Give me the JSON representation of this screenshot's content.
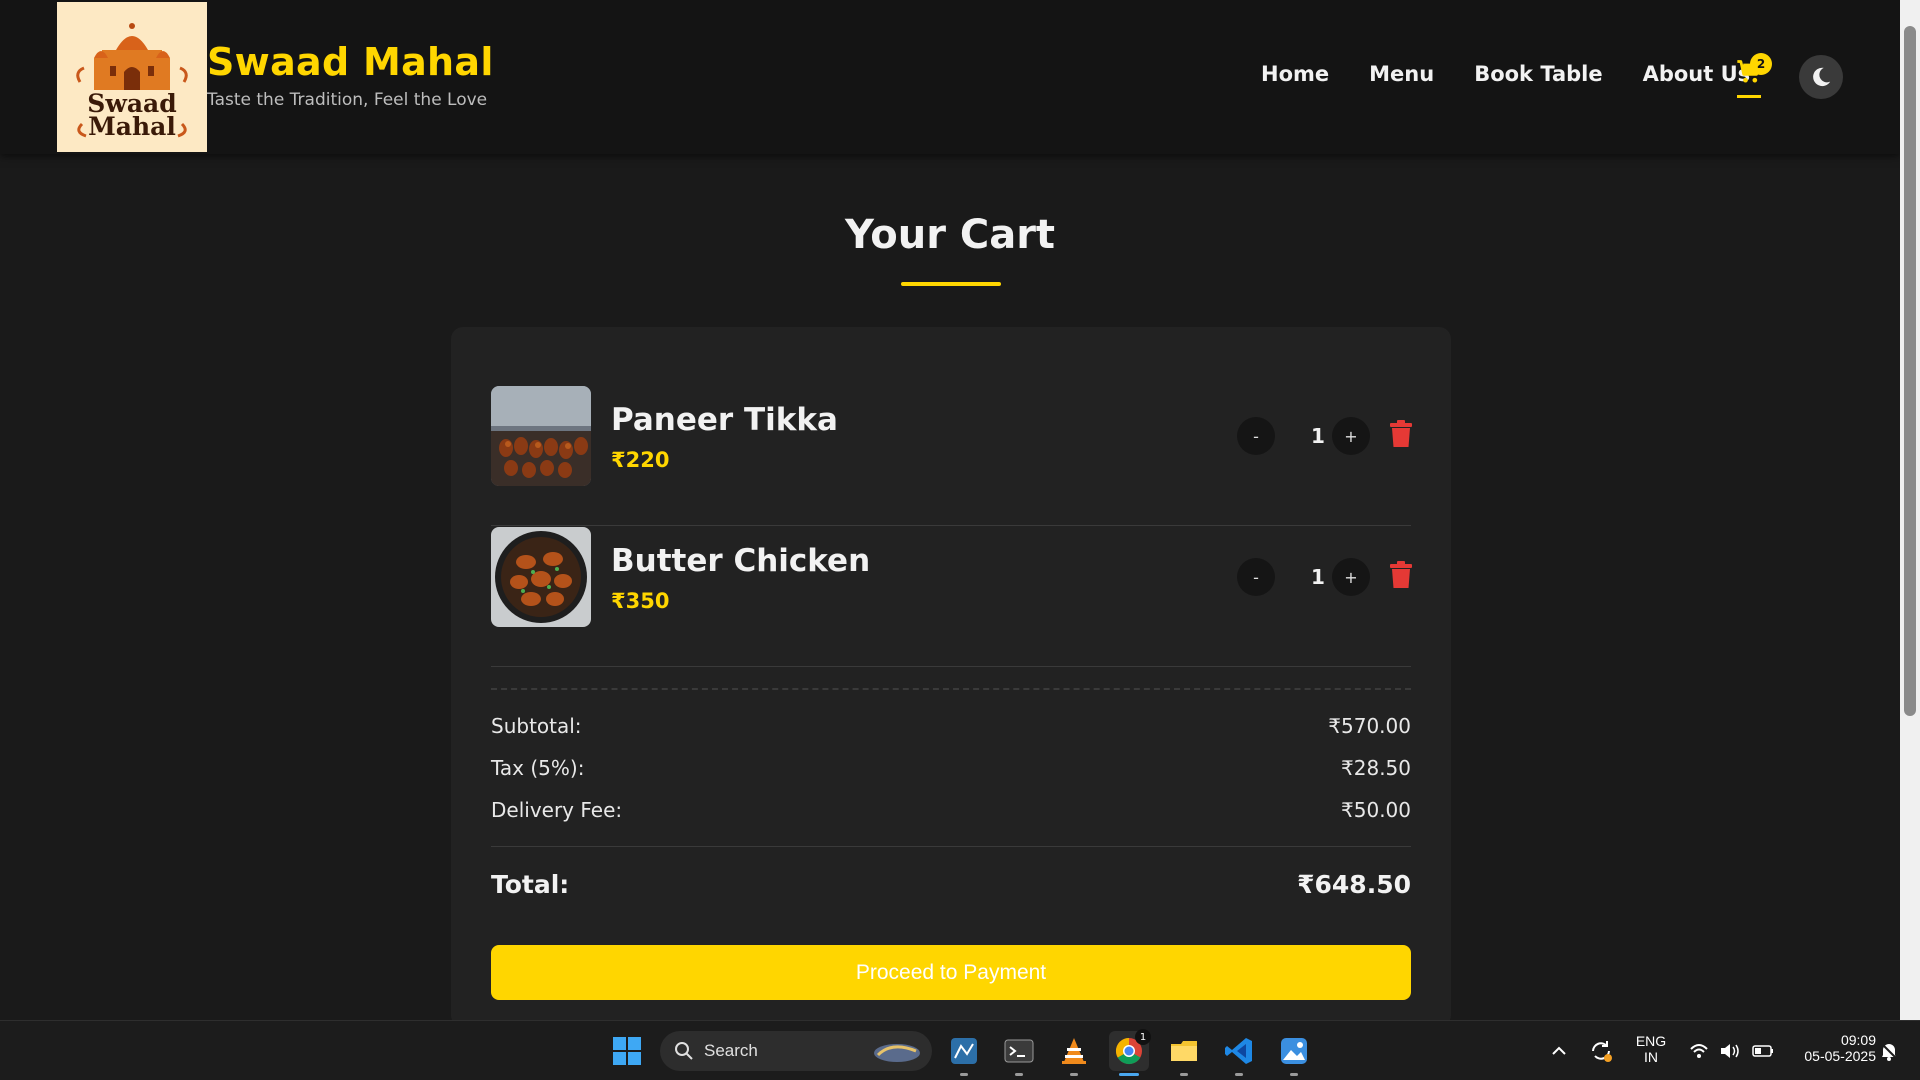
{
  "brand": {
    "logo_line1": "Swaad",
    "logo_line2": "Mahal",
    "title": "Swaad Mahal",
    "tagline": "Taste the Tradition, Feel the Love"
  },
  "nav": {
    "home": "Home",
    "menu": "Menu",
    "book": "Book Table",
    "about": "About Us",
    "cart_count": "2"
  },
  "page": {
    "title": "Your Cart"
  },
  "cart": {
    "items": [
      {
        "name": "Paneer Tikka",
        "price": "₹220",
        "qty": "1",
        "minus": "-",
        "plus": "+"
      },
      {
        "name": "Butter Chicken",
        "price": "₹350",
        "qty": "1",
        "minus": "-",
        "plus": "+"
      }
    ]
  },
  "summary": {
    "subtotal_label": "Subtotal:",
    "subtotal_value": "₹570.00",
    "tax_label": "Tax (5%):",
    "tax_value": "₹28.50",
    "delivery_label": "Delivery Fee:",
    "delivery_value": "₹50.00",
    "total_label": "Total:",
    "total_value": "₹648.50",
    "pay_button": "Proceed to Payment"
  },
  "taskbar": {
    "search_label": "Search",
    "lang_line1": "ENG",
    "lang_line2": "IN",
    "time": "09:09",
    "date": "05-05-2025",
    "chrome_badge": "1"
  },
  "colors": {
    "accent": "#ffd600",
    "danger": "#e53935",
    "background": "#1a1a1a",
    "panel": "#222222"
  }
}
